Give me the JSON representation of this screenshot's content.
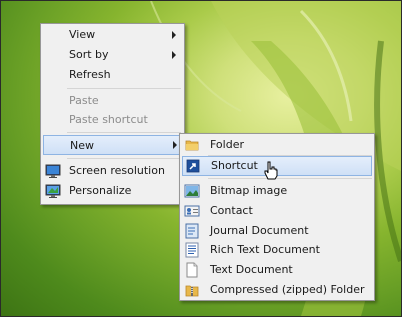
{
  "context_menu": {
    "items": [
      {
        "label": "View",
        "has_submenu": true
      },
      {
        "label": "Sort by",
        "has_submenu": true
      },
      {
        "label": "Refresh"
      },
      {
        "label": "Paste",
        "disabled": true
      },
      {
        "label": "Paste shortcut",
        "disabled": true
      },
      {
        "label": "New",
        "has_submenu": true,
        "highlighted": true,
        "icon": "none"
      },
      {
        "label": "Screen resolution",
        "icon": "monitor-icon"
      },
      {
        "label": "Personalize",
        "icon": "personalize-icon"
      }
    ]
  },
  "new_submenu": {
    "items": [
      {
        "label": "Folder",
        "icon": "folder-icon"
      },
      {
        "label": "Shortcut",
        "icon": "shortcut-icon",
        "highlighted": true
      },
      {
        "label": "Bitmap image",
        "icon": "bitmap-icon"
      },
      {
        "label": "Contact",
        "icon": "contact-icon"
      },
      {
        "label": "Journal Document",
        "icon": "journal-icon"
      },
      {
        "label": "Rich Text Document",
        "icon": "rich-text-icon"
      },
      {
        "label": "Text Document",
        "icon": "text-document-icon"
      },
      {
        "label": "Compressed (zipped) Folder",
        "icon": "zip-folder-icon"
      }
    ]
  },
  "colors": {
    "menu_bg": "#f0f0f0",
    "highlight_border": "#8eb4e3",
    "disabled_text": "#8c8c8c"
  }
}
